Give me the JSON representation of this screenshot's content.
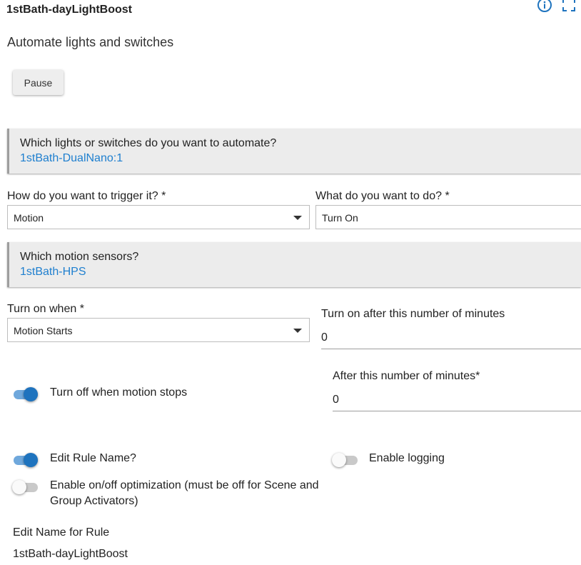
{
  "header": {
    "title": "1stBath-dayLightBoost",
    "info_icon": "info-icon",
    "fullscreen_icon": "fullscreen-icon"
  },
  "subtitle": "Automate lights and switches",
  "pause_button": "Pause",
  "devices_panel": {
    "question": "Which lights or switches do you want to automate?",
    "answer": "1stBath-DualNano:1"
  },
  "trigger": {
    "label": "How do you want to trigger it? *",
    "value": "Motion"
  },
  "action": {
    "label": "What do you want to do? *",
    "value": "Turn On"
  },
  "motion_panel": {
    "question": "Which motion sensors?",
    "answer": "1stBath-HPS"
  },
  "turn_on_when": {
    "label": "Turn on when *",
    "value": "Motion Starts"
  },
  "turn_on_after": {
    "label": "Turn on after this number of minutes",
    "value": "0"
  },
  "turn_off_toggle": {
    "label": "Turn off when motion stops",
    "on": true
  },
  "after_minutes": {
    "label": "After this number of minutes*",
    "value": "0"
  },
  "edit_rule_name_toggle": {
    "label": "Edit Rule Name?",
    "on": true
  },
  "enable_logging_toggle": {
    "label": "Enable logging",
    "on": false
  },
  "optimization_toggle": {
    "label_line1": "Enable on/off optimization (must be off for Scene and",
    "label_line2": "Group Activators)",
    "on": false
  },
  "rule_name": {
    "label": "Edit Name for Rule",
    "value": "1stBath-dayLightBoost"
  },
  "colors": {
    "accent": "#1e73be",
    "link": "#1e7fcf",
    "panel_bg": "#ececec"
  }
}
